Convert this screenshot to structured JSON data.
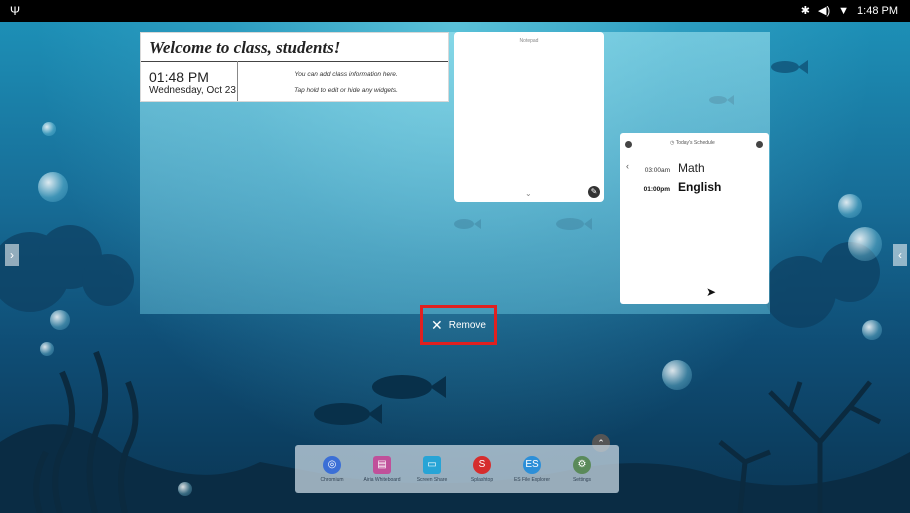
{
  "status_bar": {
    "time": "1:48 PM"
  },
  "welcome_widget": {
    "title": "Welcome to class, students!",
    "time": "01:48 PM",
    "date": "Wednesday, Oct 23",
    "info_line1": "You can add class information here.",
    "info_line2": "Tap hold to edit or hide any widgets."
  },
  "notepad_widget": {
    "title": "Notepad"
  },
  "schedule_widget": {
    "title": "Today's Schedule",
    "items": [
      {
        "time": "03:00am",
        "subject": "Math"
      },
      {
        "time": "01:00pm",
        "subject": "English"
      }
    ]
  },
  "remove_button": {
    "label": "Remove"
  },
  "dock": {
    "apps": [
      {
        "label": "Chromium",
        "icon": "chromium-icon",
        "color": "#3b6fd6"
      },
      {
        "label": "Airia Whiteboard",
        "icon": "whiteboard-icon",
        "color": "#c0509a"
      },
      {
        "label": "Screen Share",
        "icon": "screen-share-icon",
        "color": "#27a4d6"
      },
      {
        "label": "Splashtop",
        "icon": "splashtop-icon",
        "color": "#d62d2d"
      },
      {
        "label": "ES File Explorer",
        "icon": "file-explorer-icon",
        "color": "#2c8fd8"
      },
      {
        "label": "Settings",
        "icon": "settings-icon",
        "color": "#5a8a5a"
      }
    ]
  }
}
